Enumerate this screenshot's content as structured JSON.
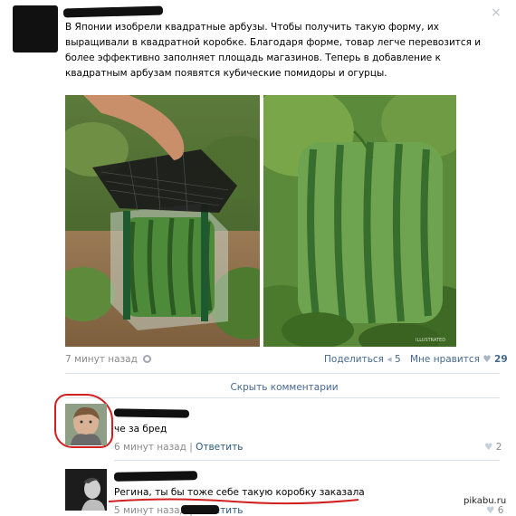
{
  "post": {
    "author_redacted": "",
    "text": "В Японии изобрели квадратные арбузы. Чтобы получить такую форму, их выращивали в квадратной коробке. Благодаря форме, товар легче перевозится и более эффективно заполняет площадь магазинов. Теперь в добавление к квадратным арбузам появятся кубические помидоры и огурцы.",
    "timestamp": "7 минут назад",
    "share_label": "Поделиться",
    "share_count": "5",
    "like_label": "Мне нравится",
    "like_count": "29",
    "close_icon": "×",
    "watermark": "ILLUSTRATED"
  },
  "comments_toggle": "Скрыть комментарии",
  "comments": [
    {
      "text": "че за бред",
      "timestamp": "6 минут назад",
      "reply_label": "Ответить",
      "like_count": "2"
    },
    {
      "text": "Регина, ты бы тоже себе такую коробку заказала",
      "timestamp": "5 минут назад",
      "reply_label": "Ответить",
      "like_count": "6"
    }
  ],
  "footer": {
    "site": "pikabu.ru"
  },
  "colors": {
    "link": "#45688e",
    "meta": "#8a8a8a",
    "divider": "#dae1e8",
    "red_circle": "#d0201f"
  }
}
